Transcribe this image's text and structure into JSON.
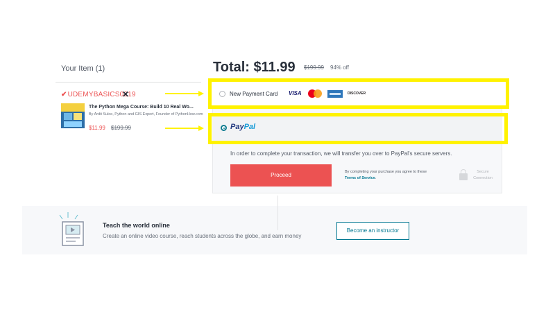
{
  "cart": {
    "header": "Your Item (1)",
    "coupon_code": "UDEMYBASICS0219",
    "check_mark": "✔",
    "remove_mark": "✕",
    "course": {
      "title": "The Python Mega Course: Build 10 Real Wo...",
      "author": "By Ardit Sulce, Python and GIS Expert, Founder of PythonHow.com",
      "price": "$11.99",
      "original_price": "$199.99"
    }
  },
  "summary": {
    "total_label": "Total: $11.99",
    "original_price": "$199.99",
    "discount": "94% off"
  },
  "payment": {
    "new_card_label": "New Payment Card",
    "card_brands": {
      "visa": "VISA",
      "discover": "DISCOVER"
    },
    "paypal_logo_part1": "Pay",
    "paypal_logo_part2": "Pal",
    "paypal_selected": true,
    "transfer_text": "In order to complete your transaction, we will transfer you over to PayPal's secure servers.",
    "proceed_label": "Proceed",
    "agree_text": "By completing your purchase you agree to these",
    "terms_link": "Terms of Service",
    "secure_text": "Secure Connection"
  },
  "banner": {
    "title": "Teach the world online",
    "subtitle": "Create an online video course, reach students across the globe, and earn money",
    "button_label": "Become an instructor"
  },
  "colors": {
    "accent_red": "#ec5252",
    "highlight_yellow": "#fff200",
    "link_teal": "#007791"
  }
}
